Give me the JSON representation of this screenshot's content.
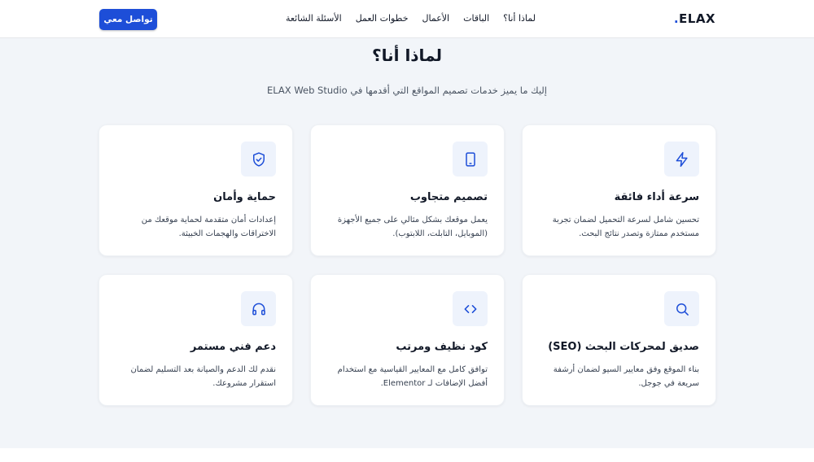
{
  "header": {
    "logo_text": "ELAX",
    "logo_dot": ".",
    "nav": [
      "لماذا أنا؟",
      "الباقات",
      "الأعمال",
      "خطوات العمل",
      "الأسئلة الشائعة"
    ],
    "contact_label": "تواصل معي"
  },
  "section": {
    "title": "لماذا أنا؟",
    "subtitle": "إليك ما يميز خدمات تصميم المواقع التي أقدمها في ELAX Web Studio"
  },
  "cards": [
    {
      "icon": "lightning-icon",
      "title": "سرعة أداء فائقة",
      "description": "تحسين شامل لسرعة التحميل لضمان تجربة مستخدم ممتازة وتصدر نتائج البحث."
    },
    {
      "icon": "smartphone-icon",
      "title": "تصميم متجاوب",
      "description": "يعمل موقعك بشكل مثالي على جميع الأجهزة (الموبايل، التابلت، اللابتوب)."
    },
    {
      "icon": "shield-check-icon",
      "title": "حماية وأمان",
      "description": "إعدادات أمان متقدمة لحماية موقعك من الاختراقات والهجمات الخبيثة."
    },
    {
      "icon": "search-icon",
      "title": "صديق لمحركات البحث (SEO)",
      "description": "بناء الموقع وفق معايير السيو لضمان أرشفة سريعة في جوجل."
    },
    {
      "icon": "code-icon",
      "title": "كود نظيف ومرتب",
      "description": "توافق كامل مع المعايير القياسية مع استخدام أفضل الإضافات لـ Elementor."
    },
    {
      "icon": "headphones-icon",
      "title": "دعم فني مستمر",
      "description": "نقدم لك الدعم والصيانة بعد التسليم لضمان استقرار مشروعك."
    }
  ],
  "colors": {
    "accent": "#1d4ed8",
    "icon_bg": "#eef3fc",
    "page_bg": "#f2f5f9"
  }
}
